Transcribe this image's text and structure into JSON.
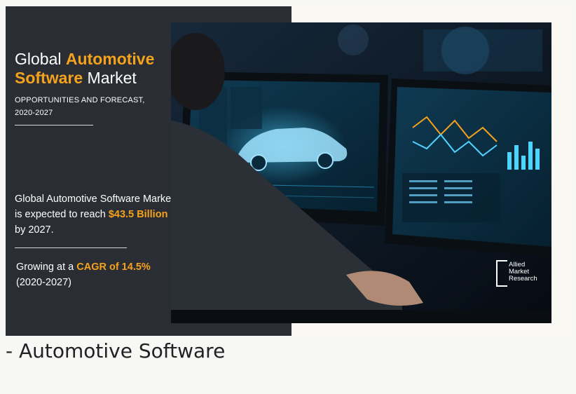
{
  "infographic": {
    "title_part1": "Global ",
    "title_accent1": "Automotive",
    "title_accent2": "Software",
    "title_part2": " Market",
    "subtitle": "OPPORTUNITIES AND FORECAST, 2020-2027",
    "stat_prefix": "Global Automotive Software Market is expected to reach ",
    "stat_value": "$43.5 Billion",
    "stat_suffix": " by 2027.",
    "growth_prefix": "Growing at a ",
    "growth_value": "CAGR of 14.5%",
    "growth_suffix": " (2020-2027)",
    "accent_color": "#f5a21c",
    "logo_lines": [
      "Allied",
      "Market",
      "Research"
    ]
  },
  "caption": "- Automotive Software"
}
